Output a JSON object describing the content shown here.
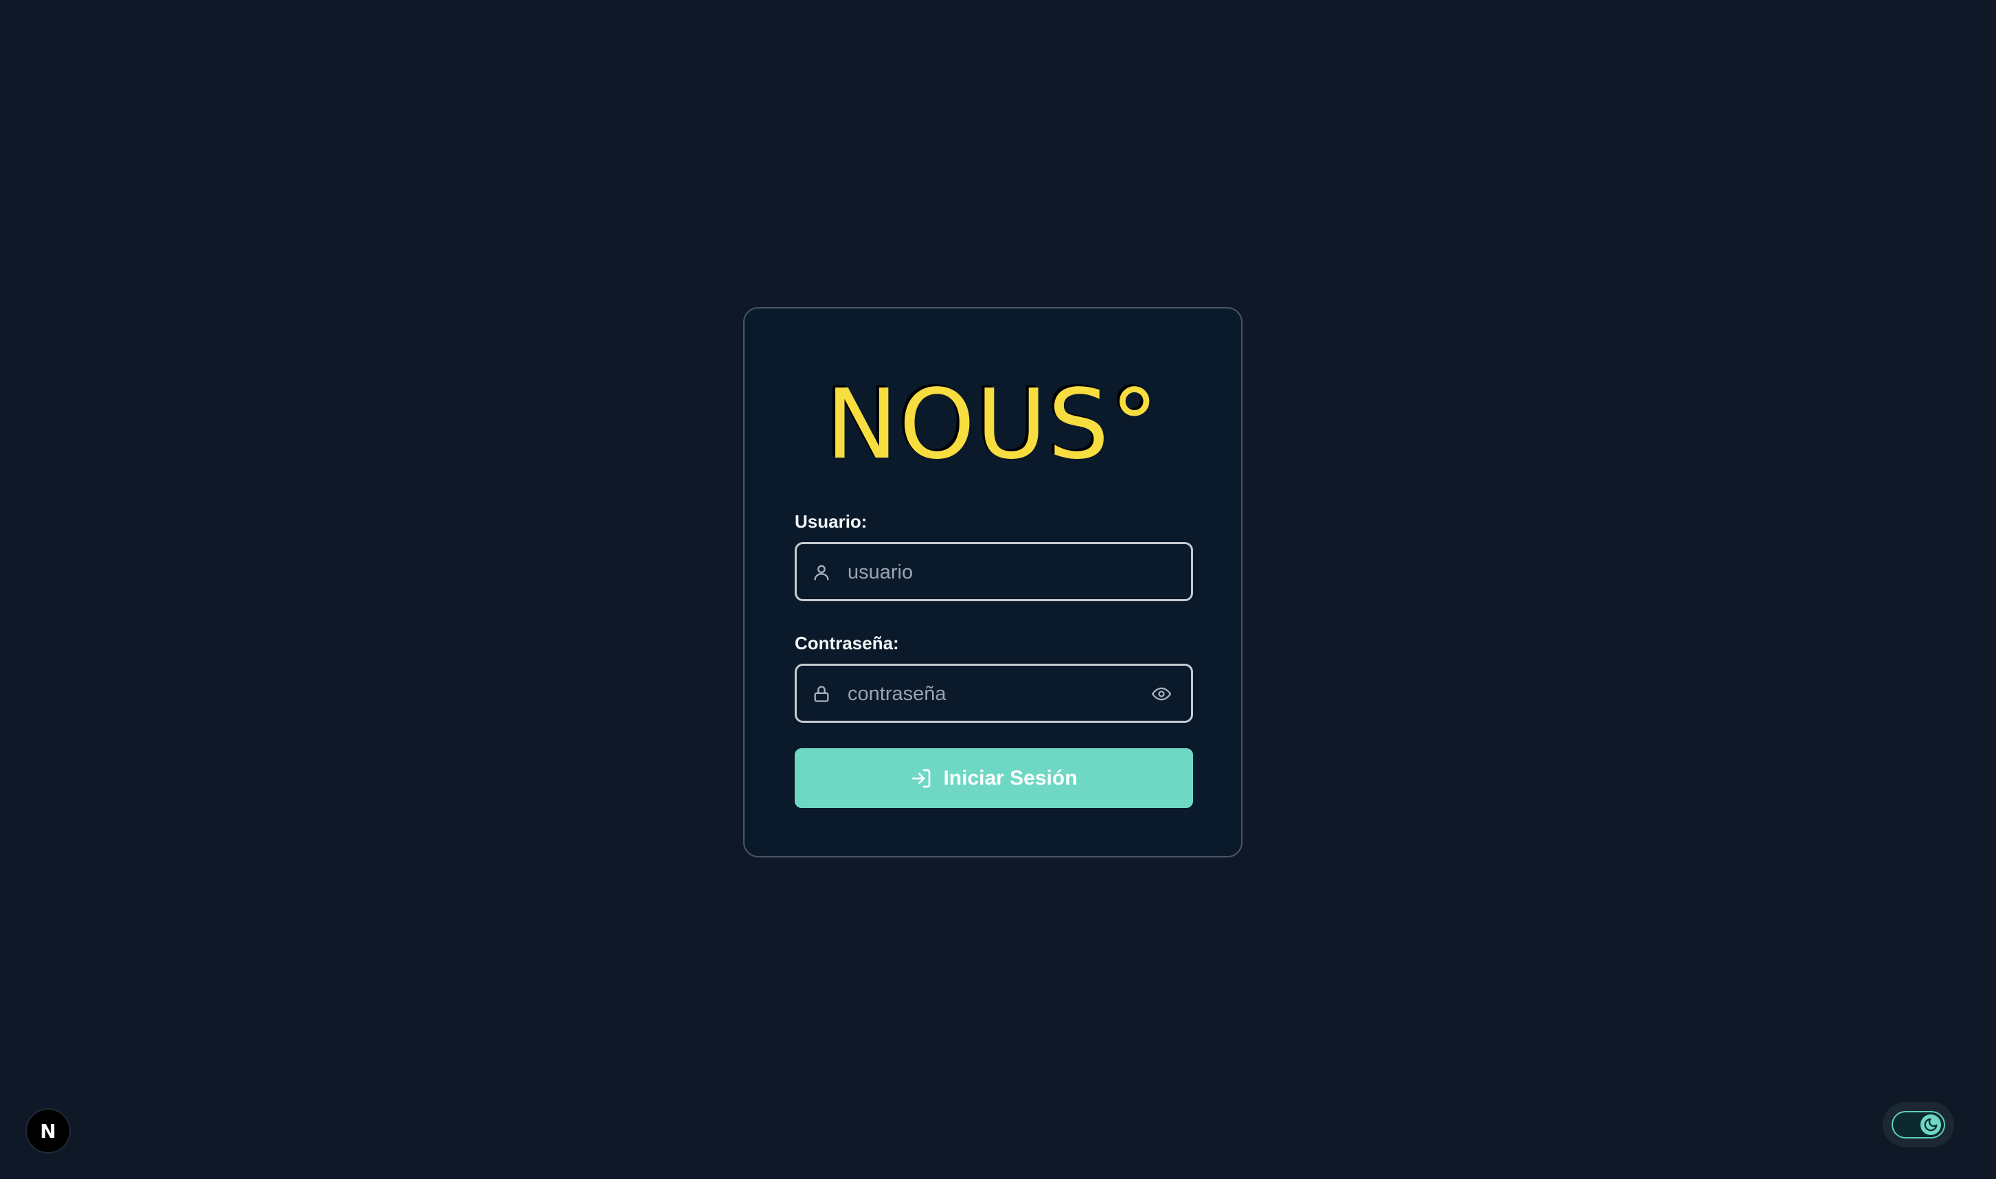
{
  "brand": {
    "logo_text": "NOUS°",
    "logo_color": "#f7dd3f",
    "accent_color": "#6fd8c5"
  },
  "login_form": {
    "username_label": "Usuario:",
    "username_placeholder": "usuario",
    "username_icon": "user-icon",
    "password_label": "Contraseña:",
    "password_placeholder": "contraseña",
    "password_icon": "lock-icon",
    "password_toggle_icon": "eye-icon",
    "submit_label": "Iniciar Sesión",
    "submit_icon": "log-in-icon"
  },
  "corner": {
    "left_badge": "N",
    "theme_toggle_icon": "moon-icon"
  }
}
